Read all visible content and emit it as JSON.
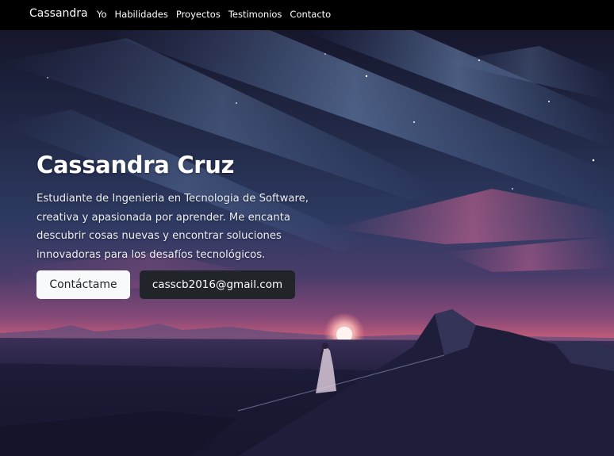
{
  "navbar": {
    "brand": "Cassandra",
    "links": [
      "Yo",
      "Habilidades",
      "Proyectos",
      "Testimonios",
      "Contacto"
    ]
  },
  "hero": {
    "title": "Cassandra Cruz",
    "description": "Estudiante de Ingenieria en Tecnologia de Software, creativa y apasionada por aprender. Me encanta descubrir cosas nuevas y encontrar soluciones innovadoras para los desafíos tecnológicos.",
    "contact_button": "Contáctame",
    "email_button": "casscb2016@gmail.com"
  },
  "colors": {
    "navbar_bg": "#000000",
    "light_button_bg": "#f8f9fa",
    "dark_button_bg": "#212529",
    "sky_top": "#1a1a35",
    "horizon_pink": "#e0607a"
  }
}
